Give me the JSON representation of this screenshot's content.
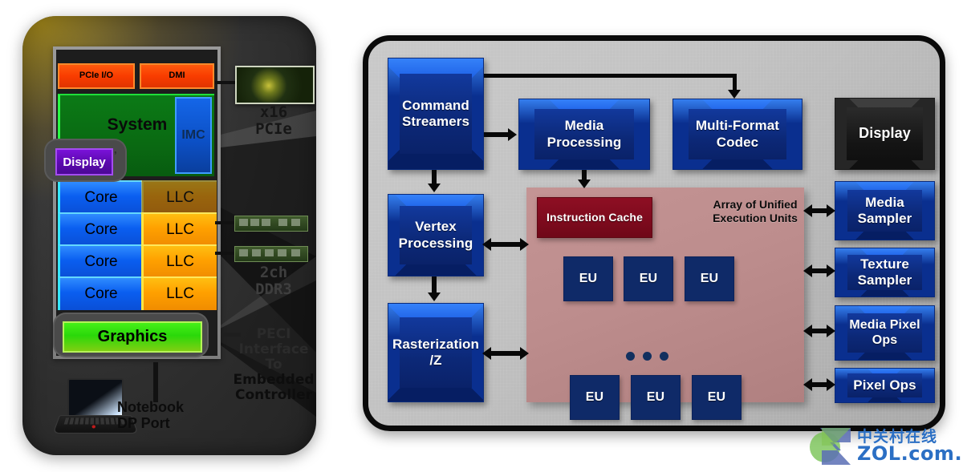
{
  "left_panel": {
    "name": "cpu-package-illustration",
    "die_blocks": {
      "pcie_io": "PCIe I/O",
      "dmi": "DMI",
      "system": "System",
      "imc": "IMC",
      "display": "Display",
      "graphics": "Graphics",
      "cores": [
        "Core",
        "Core",
        "Core",
        "Core"
      ],
      "llc": [
        "LLC",
        "LLC",
        "LLC",
        "LLC"
      ]
    },
    "external_labels": {
      "pcie": "x16\nPCIe",
      "pcie_line1": "x16",
      "pcie_line2": "PCIe",
      "memory_line1": "2ch",
      "memory_line2": "DDR3",
      "peci_line1": "PECI",
      "peci_line2": "Interface",
      "peci_line3": "To",
      "peci_line4": "Embedded",
      "peci_line5": "Controller",
      "notebook_line1": "Notebook",
      "notebook_line2": "DP Port"
    },
    "icons": {
      "graphics_card": "pcie-graphics-card-icon",
      "memory_module": "dimm-memory-icon",
      "laptop": "notebook-icon"
    }
  },
  "right_panel": {
    "name": "gpu-block-diagram",
    "blocks": {
      "command_streamers": "Command\nStreamers",
      "command_streamers_l1": "Command",
      "command_streamers_l2": "Streamers",
      "media_processing_l1": "Media",
      "media_processing_l2": "Processing",
      "multi_format_codec_l1": "Multi-Format",
      "multi_format_codec_l2": "Codec",
      "display": "Display",
      "vertex_processing_l1": "Vertex",
      "vertex_processing_l2": "Processing",
      "rasterization_l1": "Rasterization",
      "rasterization_l2": "/Z",
      "instruction_cache": "Instruction Cache",
      "array_label_l1": "Array of Unified",
      "array_label_l2": "Execution Units",
      "media_sampler_l1": "Media",
      "media_sampler_l2": "Sampler",
      "texture_sampler_l1": "Texture",
      "texture_sampler_l2": "Sampler",
      "media_pixel_ops_l1": "Media Pixel",
      "media_pixel_ops_l2": "Ops",
      "pixel_ops": "Pixel Ops",
      "eu": "EU"
    },
    "eu_units_top": [
      "EU",
      "EU",
      "EU"
    ],
    "eu_units_bottom": [
      "EU",
      "EU",
      "EU"
    ],
    "ellipsis_dots": 3
  },
  "watermark": {
    "name": "zol-watermark",
    "chinese": "中关村在线",
    "domain": "ZOL.com.cn",
    "logo_letter": "Z"
  },
  "colors": {
    "block_blue": "#0f2f86",
    "eu_navy": "#0f2a68",
    "instruction_cache_red": "#7d0a1d",
    "eu_array_pink": "#bd8d8d",
    "panel_gray": "#c2c2c2",
    "pcie_orange": "#f93c00",
    "system_green": "#0a6a12",
    "core_blue": "#0a5ef0",
    "llc_orange": "#ffa000",
    "graphics_green": "#2ad80a",
    "display_purple": "#5a09ad",
    "watermark_blue": "#2b6fc4"
  }
}
